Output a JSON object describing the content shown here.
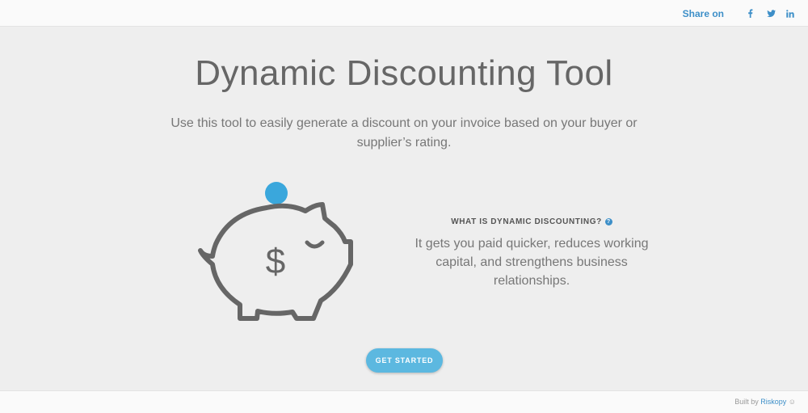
{
  "header": {
    "share_label": "Share on",
    "social": [
      {
        "icon": "facebook-icon",
        "glyph": "f"
      },
      {
        "icon": "twitter-icon",
        "glyph": "t"
      },
      {
        "icon": "linkedin-icon",
        "glyph": "in"
      }
    ]
  },
  "main": {
    "title": "Dynamic Discounting Tool",
    "subtitle": "Use this tool to easily generate a discount on your invoice based on your buyer or supplier’s rating.",
    "info_heading": "WHAT IS DYNAMIC DISCOUNTING?",
    "info_help_glyph": "?",
    "info_text": "It gets you paid quicker, reduces working capital, and strengthens business relationships.",
    "illustration": {
      "icon": "piggy-bank-icon",
      "coin_icon": "coin-icon",
      "symbol": "$"
    },
    "cta_label": "GET STARTED"
  },
  "footer": {
    "built_by": "Built by",
    "link_text": "Riskopy",
    "smiley": "☺"
  },
  "colors": {
    "accent": "#3d8fc8",
    "button": "#5cb8e0",
    "coin": "#3aa7dc",
    "piggy_stroke": "#666666",
    "background": "#eeeeee"
  }
}
